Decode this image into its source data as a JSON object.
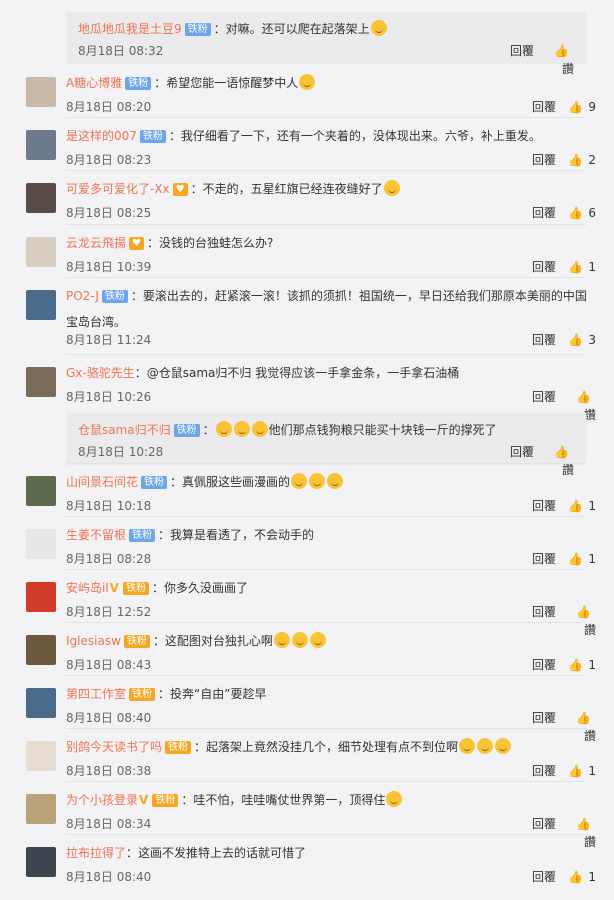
{
  "reply_label": "回覆",
  "top_sub": {
    "name": "地瓜地瓜我是土豆9",
    "badge": "铁粉",
    "text": "：对嘛。还可以爬在起落架上",
    "emoji": "smile-emoji",
    "time": "8月18日 08:32",
    "like": "讚"
  },
  "comments": [
    {
      "name": "A糖心博雅",
      "badge": "铁粉",
      "badge_style": "blue",
      "text": "：希望您能一语惊醒梦中人",
      "emoji_count": 1,
      "time": "8月18日 08:20",
      "like": "9",
      "avatar_color": "#c9b8a6"
    },
    {
      "name": "是这样的007",
      "badge": "铁粉",
      "badge_style": "blue",
      "text": "：我仔细看了一下，还有一个夹着的，没体现出来。六爷，补上重发。",
      "emoji_count": 0,
      "time": "8月18日 08:23",
      "like": "2",
      "avatar_color": "#6b7a8c"
    },
    {
      "name": "可爱多可爱化了-Xx",
      "badge": "",
      "badge_style": "heart",
      "text": "：不走的，五星红旗已经连夜缝好了",
      "emoji_count": 1,
      "time": "8月18日 08:25",
      "like": "6",
      "avatar_color": "#5a4a48"
    },
    {
      "name": "云龙云飛揚",
      "badge": "",
      "badge_style": "heart",
      "text": "：没钱的台独蛙怎么办?",
      "emoji_count": 0,
      "time": "8月18日 10:39",
      "like": "1",
      "avatar_color": "#d8cdbf"
    },
    {
      "name": "PO2-J",
      "badge": "铁粉",
      "badge_style": "blue",
      "text": "：要滚出去的，赶紧滚一滚！该抓的须抓！祖国统一，早日还给我们那原本美丽的中国",
      "text2": "宝岛台湾。",
      "emoji_count": 0,
      "time": "8月18日 11:24",
      "like": "3",
      "avatar_color": "#4b6b8a"
    },
    {
      "name": "Gx-骆驼先生",
      "badge": "",
      "badge_style": "none",
      "text": "：@仓鼠sama归不归 我觉得应该一手拿金条，一手拿石油桶",
      "emoji_count": 0,
      "time": "8月18日 10:26",
      "like": "讚",
      "avatar_color": "#7b6a58"
    },
    {
      "name": "山间景石间花",
      "badge": "铁粉",
      "badge_style": "blue",
      "text": "：真佩服这些画漫画的",
      "emoji_count": 3,
      "time": "8月18日 10:18",
      "like": "1",
      "avatar_color": "#5d6a4d"
    },
    {
      "name": "生姜不留根",
      "badge": "铁粉",
      "badge_style": "blue",
      "text": "：我算是看透了，不会动手的",
      "emoji_count": 0,
      "time": "8月18日 08:28",
      "like": "1",
      "avatar_color": "#e6e6e6"
    },
    {
      "name": "安屿岛il",
      "badge": "铁粉",
      "badge_style": "gold-v",
      "text": "：你多久没画画了",
      "emoji_count": 0,
      "time": "8月18日 12:52",
      "like": "讚",
      "avatar_color": "#d23a2a"
    },
    {
      "name": "Iglesiasw",
      "badge": "铁粉",
      "badge_style": "gold",
      "text": "：这配图对台独扎心啊",
      "emoji_count": 3,
      "time": "8月18日 08:43",
      "like": "1",
      "avatar_color": "#6b5a3e"
    },
    {
      "name": "第四工作室",
      "badge": "铁粉",
      "badge_style": "gold",
      "text": "：投奔“自由”要趁早",
      "emoji_count": 0,
      "time": "8月18日 08:40",
      "like": "讚",
      "avatar_color": "#4a6a8a"
    },
    {
      "name": "别鸽今天读书了吗",
      "badge": "铁粉",
      "badge_style": "gold",
      "text": "：起落架上竟然没挂几个，细节处理有点不到位啊",
      "emoji_count": 3,
      "time": "8月18日 08:38",
      "like": "1",
      "avatar_color": "#e8dcd0"
    },
    {
      "name": "为个小孩登录",
      "badge": "铁粉",
      "badge_style": "gold-v",
      "text": "：哇不怕，哇哇嘴仗世界第一，顶得住",
      "emoji_count": 1,
      "time": "8月18日 08:34",
      "like": "讚",
      "avatar_color": "#b9a27a"
    },
    {
      "name": "拉布拉得了",
      "badge": "",
      "badge_style": "none",
      "text": "：这画不发推特上去的话就可惜了",
      "emoji_count": 0,
      "time": "8月18日 08:40",
      "like": "1",
      "avatar_color": "#3d4650"
    }
  ],
  "nested_sub": {
    "name": "仓鼠sama归不归",
    "badge": "铁粉",
    "text": "他们那点钱狗粮只能买十块钱一斤的撑死了",
    "emoji_count": 3,
    "time": "8月18日 10:28",
    "like": "讚"
  }
}
